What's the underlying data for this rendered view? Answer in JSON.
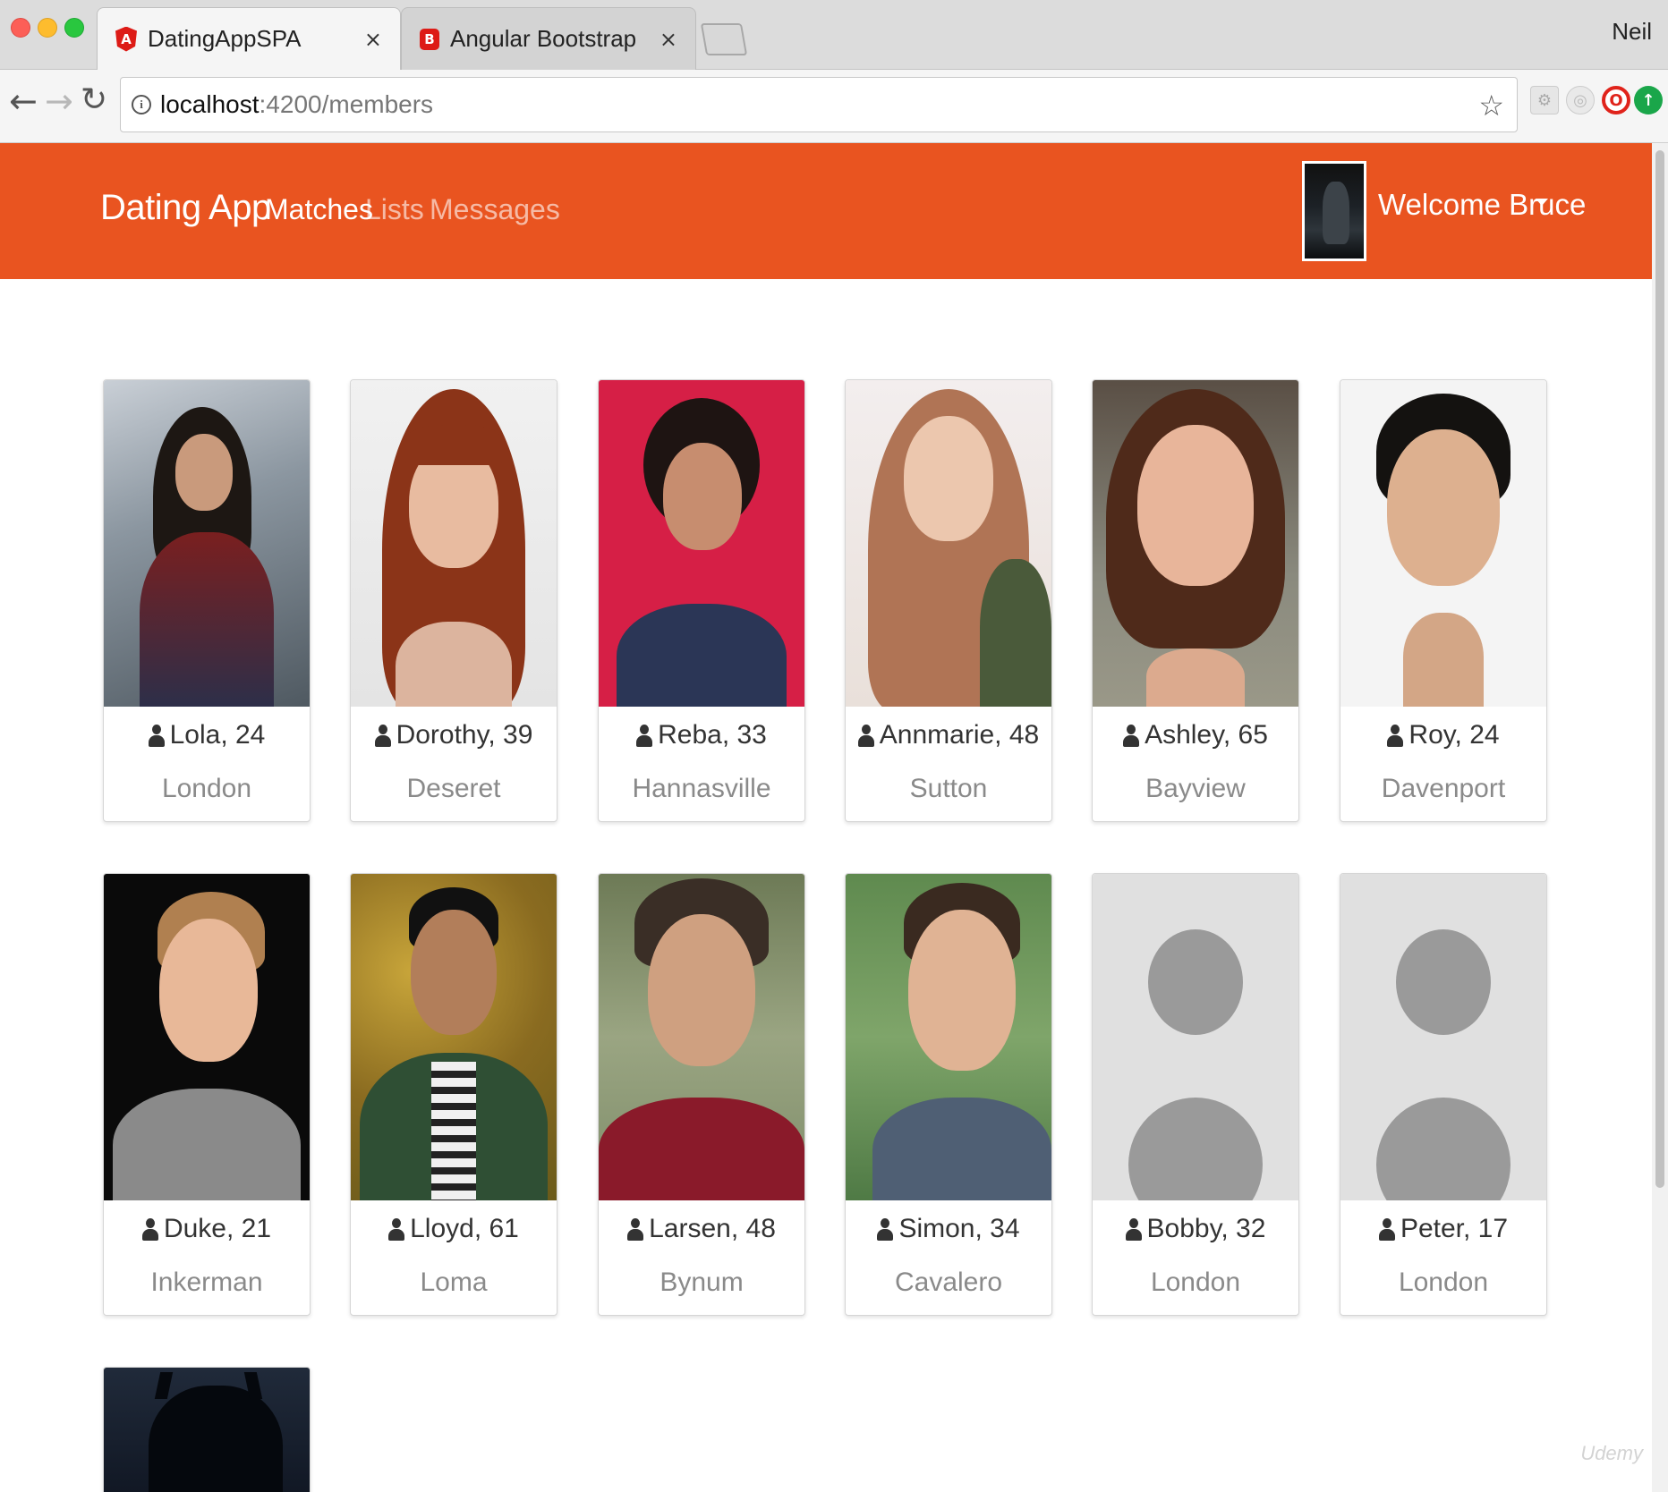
{
  "browser": {
    "tabs": [
      {
        "title": "DatingAppSPA",
        "icon": "angular-icon",
        "active": true
      },
      {
        "title": "Angular Bootstrap",
        "icon": "bootstrap-icon",
        "active": false
      }
    ],
    "profile_name": "Neil",
    "url_host": "localhost",
    "url_path": ":4200/members"
  },
  "navbar": {
    "brand": "Dating App",
    "links": [
      "Matches",
      "Lists",
      "Messages"
    ],
    "active_link": "Matches",
    "welcome": "Welcome Bruce",
    "accent_color": "#e95420"
  },
  "members": [
    {
      "name": "Lola, 24",
      "city": "London"
    },
    {
      "name": "Dorothy, 39",
      "city": "Deseret"
    },
    {
      "name": "Reba, 33",
      "city": "Hannasville"
    },
    {
      "name": "Annmarie, 48",
      "city": "Sutton"
    },
    {
      "name": "Ashley, 65",
      "city": "Bayview"
    },
    {
      "name": "Roy, 24",
      "city": "Davenport"
    },
    {
      "name": "Duke, 21",
      "city": "Inkerman"
    },
    {
      "name": "Lloyd, 61",
      "city": "Loma"
    },
    {
      "name": "Larsen, 48",
      "city": "Bynum"
    },
    {
      "name": "Simon, 34",
      "city": "Cavalero"
    },
    {
      "name": "Bobby, 32",
      "city": "London"
    },
    {
      "name": "Peter, 17",
      "city": "London"
    }
  ]
}
